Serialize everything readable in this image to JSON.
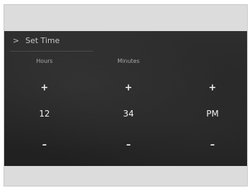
{
  "header": {
    "back_icon": "chevron-right-icon",
    "title": "Set Time"
  },
  "columns": {
    "hours": {
      "label": "Hours",
      "value": "12",
      "increment": "+",
      "decrement": "–"
    },
    "minutes": {
      "label": "Minutes",
      "value": "34",
      "increment": "+",
      "decrement": "–"
    },
    "ampm": {
      "label": "",
      "value": "PM",
      "increment": "+",
      "decrement": "–"
    }
  },
  "colors": {
    "screen_background": "#262626",
    "text_primary": "#f2f2f2",
    "text_secondary": "#a9a9a9",
    "frame_background": "#dcdcdc"
  }
}
